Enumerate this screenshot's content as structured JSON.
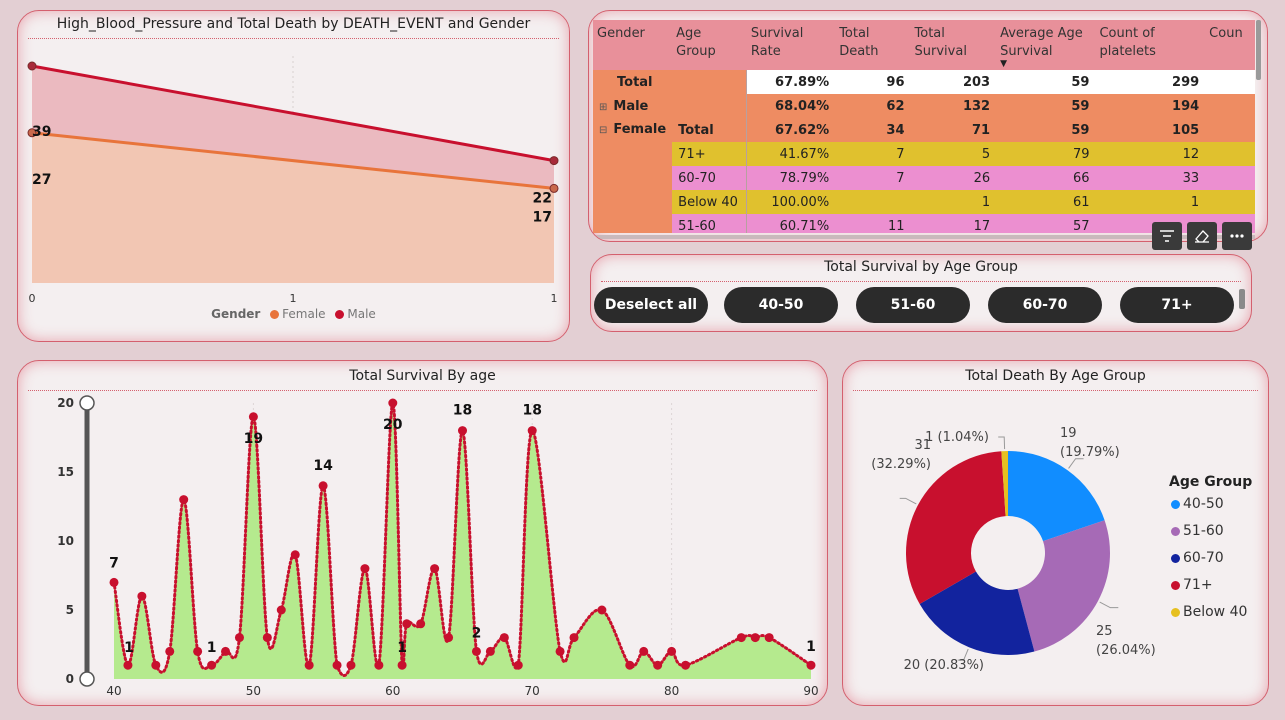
{
  "colors": {
    "female": "#e8743b",
    "male": "#c8102e",
    "age_40_50": "#118dff",
    "age_51_60": "#a66ab6",
    "age_60_70": "#12239e",
    "age_71_plus": "#c8102e",
    "age_below_40": "#e6c020",
    "survival_area": "#b5ea8e",
    "survival_line": "#c8102e"
  },
  "toolbar": {
    "filter_icon": "filter-icon",
    "eraser_icon": "eraser-icon",
    "more_icon": "more-options-icon"
  },
  "matrix": {
    "headers": [
      "Gender",
      "Age Group",
      "Survival Rate",
      "Total Death",
      "Total Survival",
      "Average Age Survival",
      "Count of platelets",
      "Coun"
    ],
    "sort_indicator": "▼",
    "total": {
      "label": "Total",
      "values": [
        "67.89%",
        "96",
        "203",
        "59",
        "299"
      ]
    },
    "male": {
      "label": "Male",
      "values": [
        "68.04%",
        "62",
        "132",
        "59",
        "194"
      ]
    },
    "female": {
      "label": "Female",
      "group": "Total",
      "values": [
        "67.62%",
        "34",
        "71",
        "59",
        "105"
      ]
    },
    "rows": [
      {
        "age": "71+",
        "values": [
          "41.67%",
          "7",
          "5",
          "79",
          "12"
        ],
        "color": "yellow"
      },
      {
        "age": "60-70",
        "values": [
          "78.79%",
          "7",
          "26",
          "66",
          "33"
        ],
        "color": "pink"
      },
      {
        "age": "Below 40",
        "values": [
          "100.00%",
          "",
          "1",
          "61",
          "1"
        ],
        "color": "yellow"
      },
      {
        "age": "51-60",
        "values": [
          "60.71%",
          "11",
          "17",
          "57",
          ""
        ],
        "color": "pink"
      }
    ]
  },
  "slicer": {
    "title": "Total Survival by Age Group",
    "buttons": [
      "Deselect all",
      "40-50",
      "51-60",
      "60-70",
      "71+"
    ]
  },
  "charts": {
    "bp": {
      "chart_data": {
        "type": "area",
        "title": "High_Blood_Pressure and Total Death by DEATH_EVENT and Gender",
        "x": [
          0,
          1
        ],
        "x_ticks": [
          "0",
          "1",
          "1"
        ],
        "series": [
          {
            "name": "Female",
            "values": [
              27,
              17
            ]
          },
          {
            "name": "Male",
            "values": [
              39,
              22
            ]
          }
        ],
        "legend_title": "Gender",
        "legend_position": "bottom-center"
      }
    },
    "survival": {
      "chart_data": {
        "type": "area",
        "title": "Total Survival By age",
        "x": [
          40,
          41,
          42,
          43,
          44,
          45,
          46,
          47,
          48,
          49,
          50,
          51,
          52,
          53,
          54,
          55,
          56,
          57,
          58,
          59,
          60,
          60.667,
          61,
          62,
          63,
          64,
          65,
          66,
          67,
          68,
          69,
          70,
          72,
          73,
          75,
          77,
          78,
          79,
          80,
          81,
          85,
          86,
          87,
          90
        ],
        "y": [
          7,
          1,
          6,
          1,
          2,
          13,
          2,
          1,
          2,
          3,
          19,
          3,
          5,
          9,
          1,
          14,
          1,
          1,
          8,
          1,
          20,
          1,
          4,
          4,
          8,
          3,
          18,
          2,
          2,
          3,
          1,
          18,
          2,
          3,
          5,
          1,
          2,
          1,
          2,
          1,
          3,
          3,
          3,
          1
        ],
        "labels": [
          {
            "x": 40,
            "text": "7"
          },
          {
            "x": 41,
            "text": "1"
          },
          {
            "x": 47,
            "text": "1"
          },
          {
            "x": 50,
            "text": "19"
          },
          {
            "x": 55,
            "text": "14"
          },
          {
            "x": 60,
            "text": "20"
          },
          {
            "x": 60.667,
            "text": "1"
          },
          {
            "x": 65,
            "text": "18"
          },
          {
            "x": 66,
            "text": "2"
          },
          {
            "x": 70,
            "text": "18"
          },
          {
            "x": 90,
            "text": "1"
          }
        ],
        "x_ticks": [
          "40",
          "50",
          "60",
          "70",
          "80",
          "90"
        ],
        "y_ticks": [
          "0",
          "5",
          "10",
          "15",
          "20"
        ],
        "xlim": [
          40,
          90
        ],
        "ylim": [
          0,
          20
        ]
      }
    },
    "donut": {
      "chart_data": {
        "type": "pie",
        "title": "Total Death By Age Group",
        "categories": [
          "40-50",
          "51-60",
          "60-70",
          "71+",
          "Below 40"
        ],
        "values": [
          19,
          25,
          20,
          31,
          1
        ],
        "data_labels": [
          {
            "count": "19",
            "pct": "(19.79%)"
          },
          {
            "count": "25",
            "pct": "(26.04%)"
          },
          {
            "count": "20 (20.83%)",
            "pct": ""
          },
          {
            "count": "31",
            "pct": "(32.29%)"
          },
          {
            "count": "1 (1.04%)",
            "pct": ""
          }
        ],
        "legend_title": "Age Group",
        "legend_position": "right"
      }
    }
  }
}
